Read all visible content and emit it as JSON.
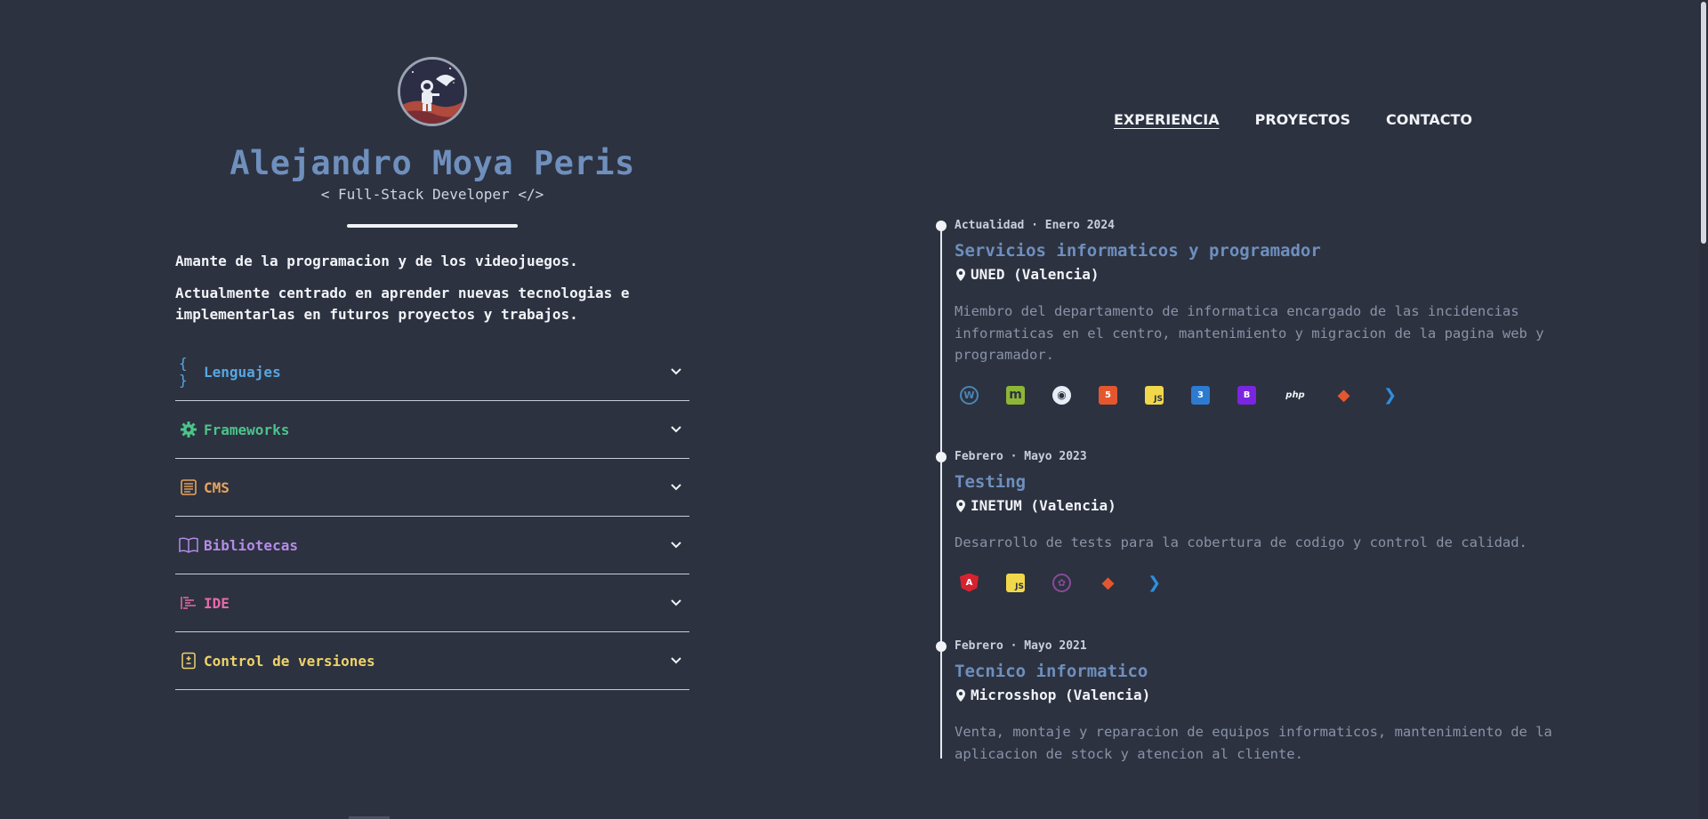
{
  "profile": {
    "name": "Alejandro Moya Peris",
    "role": "< Full-Stack Developer </>",
    "bio": [
      "Amante de la programacion y de los videojuegos.",
      "Actualmente centrado en aprender nuevas tecnologias e implementarlas en futuros proyectos y trabajos."
    ]
  },
  "skills": [
    {
      "label": "Lenguajes",
      "color": "#58a6e0",
      "icon": "braces-icon"
    },
    {
      "label": "Frameworks",
      "color": "#4cc38a",
      "icon": "gear-icon"
    },
    {
      "label": "CMS",
      "color": "#e8a35c",
      "icon": "document-icon"
    },
    {
      "label": "Bibliotecas",
      "color": "#b48be8",
      "icon": "book-icon"
    },
    {
      "label": "IDE",
      "color": "#e86aa8",
      "icon": "code-lines-icon"
    },
    {
      "label": "Control de versiones",
      "color": "#eed36a",
      "icon": "git-file-icon"
    }
  ],
  "nav": [
    {
      "label": "EXPERIENCIA",
      "active": true
    },
    {
      "label": "PROYECTOS",
      "active": false
    },
    {
      "label": "CONTACTO",
      "active": false
    }
  ],
  "experience": [
    {
      "date": "Actualidad · Enero 2024",
      "title": "Servicios informaticos y programador",
      "place": "UNED (Valencia)",
      "desc": "Miembro del departamento de informatica encargado de las incidencias informaticas en el centro, mantenimiento y migracion de la pagina web y programador.",
      "tech": [
        "wordpress-icon",
        "moodle-icon",
        "postman-icon",
        "html5-icon",
        "javascript-icon",
        "css3-icon",
        "bootstrap-icon",
        "php-icon",
        "git-icon",
        "vscode-icon"
      ]
    },
    {
      "date": "Febrero · Mayo 2023",
      "title": "Testing",
      "place": "INETUM (Valencia)",
      "desc": "Desarrollo de tests para la cobertura de codigo y control de calidad.",
      "tech": [
        "angular-icon",
        "javascript-icon",
        "jasmine-icon",
        "git-icon",
        "vscode-icon"
      ]
    },
    {
      "date": "Febrero · Mayo 2021",
      "title": "Tecnico informatico",
      "place": "Microsshop (Valencia)",
      "desc": "Venta, montaje y reparacion de equipos informaticos, mantenimiento de la aplicacion de stock y atencion al cliente.",
      "tech": []
    }
  ],
  "tech_glyphs": {
    "moodle-icon": "m",
    "html5-icon": "5",
    "javascript-icon": "JS",
    "css3-icon": "3",
    "bootstrap-icon": "B",
    "php-icon": "php",
    "git-icon": "◆",
    "vscode-icon": "❯",
    "wordpress-icon": "W",
    "postman-icon": "◉",
    "angular-icon": "A",
    "jasmine-icon": "✿"
  }
}
